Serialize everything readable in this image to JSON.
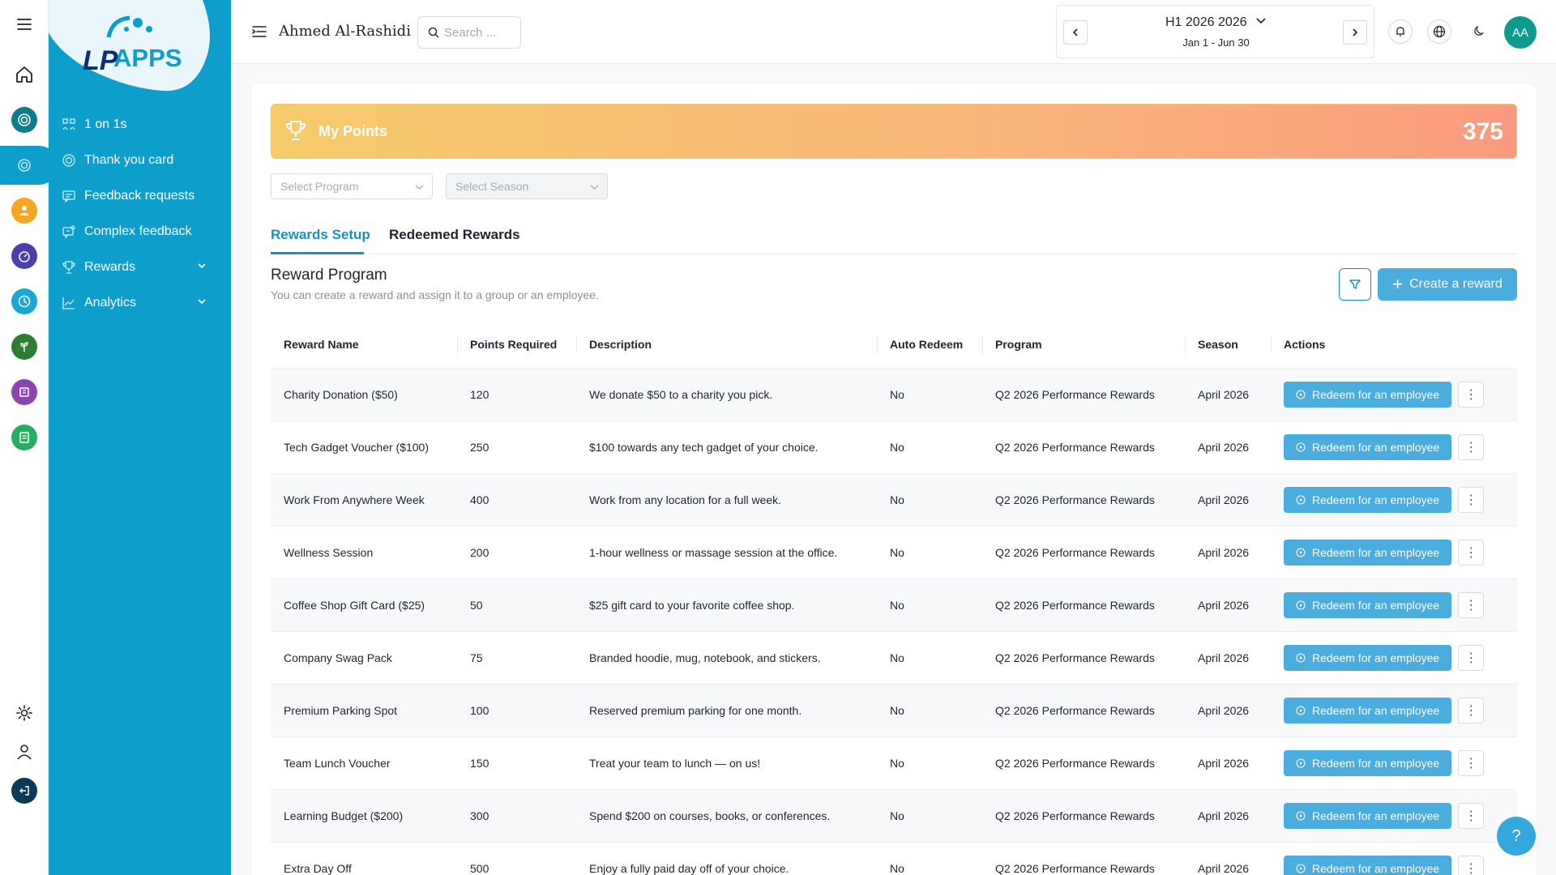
{
  "brand": {
    "logo_text": "APPS",
    "logo_prefix": "LP",
    "accent": "#0d9ecb",
    "button": "#4bacde"
  },
  "rail": {
    "items": [
      {
        "name": "menu-icon",
        "color": ""
      },
      {
        "name": "home-icon",
        "color": ""
      },
      {
        "name": "target-icon",
        "color": "#0e7c8c"
      },
      {
        "name": "fingerprint-icon",
        "color": "#0d9ecb"
      },
      {
        "name": "people-icon",
        "color": "#f5a623"
      },
      {
        "name": "gauge-icon",
        "color": "#4b3fb0"
      },
      {
        "name": "clock-icon",
        "color": "#1aa7d6"
      },
      {
        "name": "plant-icon",
        "color": "#2f7d32"
      },
      {
        "name": "board-icon",
        "color": "#8e44ad"
      },
      {
        "name": "checklist-icon",
        "color": "#27ae60"
      },
      {
        "name": "gear-icon",
        "color": ""
      },
      {
        "name": "user-icon",
        "color": ""
      },
      {
        "name": "logout-icon",
        "color": "#0b3a57"
      }
    ]
  },
  "nav": {
    "items": [
      {
        "label": "1 on 1s",
        "icon": "people-icon"
      },
      {
        "label": "Thank you card",
        "icon": "fingerprint-icon"
      },
      {
        "label": "Feedback requests",
        "icon": "feedback-icon"
      },
      {
        "label": "Complex feedback",
        "icon": "chat-icon"
      },
      {
        "label": "Rewards",
        "icon": "trophy-icon"
      },
      {
        "label": "Analytics",
        "icon": "chart-icon"
      }
    ]
  },
  "topbar": {
    "user_name": "Ahmed Al-Rashidi",
    "search_placeholder": "Search ...",
    "period_title": "H1 2026 2026",
    "period_range": "Jan 1 - Jun 30",
    "avatar_initials": "AA"
  },
  "points": {
    "label": "My Points",
    "value": "375"
  },
  "filters": {
    "program_placeholder": "Select Program",
    "season_placeholder": "Select Season"
  },
  "tabs": {
    "setup": "Rewards Setup",
    "redeemed": "Redeemed Rewards"
  },
  "section": {
    "title": "Reward Program",
    "subtitle": "You can create a reward and assign it to a group or an employee.",
    "create_label": "Create a reward"
  },
  "table": {
    "headers": [
      "Reward Name",
      "Points Required",
      "Description",
      "Auto Redeem",
      "Program",
      "Season",
      "Actions"
    ],
    "action_label": "Redeem for an employee",
    "more_label": "⋮",
    "rows": [
      {
        "name": "Charity Donation ($50)",
        "points": "120",
        "description": "We donate $50 to a charity you pick.",
        "auto": "No",
        "program": "Q2 2026 Performance Rewards",
        "season": "April 2026"
      },
      {
        "name": "Tech Gadget Voucher ($100)",
        "points": "250",
        "description": "$100 towards any tech gadget of your choice.",
        "auto": "No",
        "program": "Q2 2026 Performance Rewards",
        "season": "April 2026"
      },
      {
        "name": "Work From Anywhere Week",
        "points": "400",
        "description": "Work from any location for a full week.",
        "auto": "No",
        "program": "Q2 2026 Performance Rewards",
        "season": "April 2026"
      },
      {
        "name": "Wellness Session",
        "points": "200",
        "description": "1-hour wellness or massage session at the office.",
        "auto": "No",
        "program": "Q2 2026 Performance Rewards",
        "season": "April 2026"
      },
      {
        "name": "Coffee Shop Gift Card ($25)",
        "points": "50",
        "description": "$25 gift card to your favorite coffee shop.",
        "auto": "No",
        "program": "Q2 2026 Performance Rewards",
        "season": "April 2026"
      },
      {
        "name": "Company Swag Pack",
        "points": "75",
        "description": "Branded hoodie, mug, notebook, and stickers.",
        "auto": "No",
        "program": "Q2 2026 Performance Rewards",
        "season": "April 2026"
      },
      {
        "name": "Premium Parking Spot",
        "points": "100",
        "description": "Reserved premium parking for one month.",
        "auto": "No",
        "program": "Q2 2026 Performance Rewards",
        "season": "April 2026"
      },
      {
        "name": "Team Lunch Voucher",
        "points": "150",
        "description": "Treat your team to lunch — on us!",
        "auto": "No",
        "program": "Q2 2026 Performance Rewards",
        "season": "April 2026"
      },
      {
        "name": "Learning Budget ($200)",
        "points": "300",
        "description": "Spend $200 on courses, books, or conferences.",
        "auto": "No",
        "program": "Q2 2026 Performance Rewards",
        "season": "April 2026"
      },
      {
        "name": "Extra Day Off",
        "points": "500",
        "description": "Enjoy a fully paid day off of your choice.",
        "auto": "No",
        "program": "Q2 2026 Performance Rewards",
        "season": "April 2026"
      }
    ]
  },
  "help": {
    "label": "?"
  }
}
